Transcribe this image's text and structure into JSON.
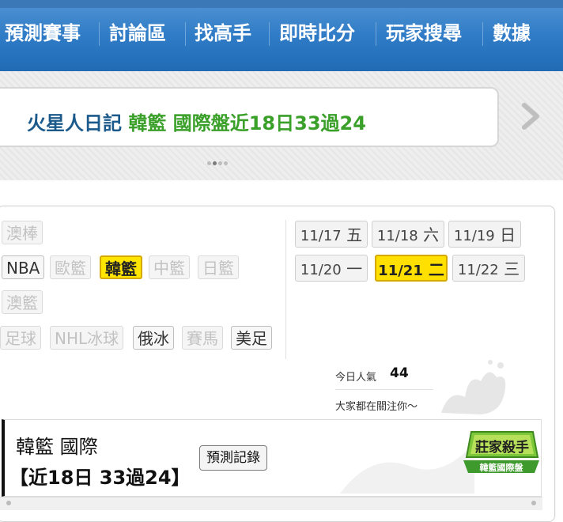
{
  "nav": {
    "items": [
      "預測賽事",
      "討論區",
      "找高手",
      "即時比分",
      "玩家搜尋",
      "數據"
    ]
  },
  "banner": {
    "name": "火星人日記",
    "category": "韓籃",
    "headline": "國際盤近18日33過24",
    "icons": {
      "next": "chevron-right-icon"
    },
    "slide_count": 4,
    "active_slide": 2
  },
  "filters": {
    "rows": [
      [
        {
          "label": "澳棒",
          "state": "off"
        }
      ],
      [
        {
          "label": "NBA",
          "state": "on"
        },
        {
          "label": "歐籃",
          "state": "off"
        },
        {
          "label": "韓籃",
          "state": "selected"
        },
        {
          "label": "中籃",
          "state": "off"
        },
        {
          "label": "日籃",
          "state": "off"
        }
      ],
      [
        {
          "label": "澳籃",
          "state": "off"
        }
      ],
      [
        {
          "label": "足球",
          "state": "off"
        },
        {
          "label": "NHL冰球",
          "state": "off"
        },
        {
          "label": "俄冰",
          "state": "on"
        },
        {
          "label": "賽馬",
          "state": "off"
        },
        {
          "label": "美足",
          "state": "on"
        }
      ]
    ]
  },
  "dates": [
    {
      "date": "11/17",
      "weekday": "五",
      "selected": false
    },
    {
      "date": "11/18",
      "weekday": "六",
      "selected": false
    },
    {
      "date": "11/19",
      "weekday": "日",
      "selected": false
    },
    {
      "date": "11/20",
      "weekday": "一",
      "selected": false
    },
    {
      "date": "11/21",
      "weekday": "二",
      "selected": true
    },
    {
      "date": "11/22",
      "weekday": "三",
      "selected": false
    }
  ],
  "popularity": {
    "label": "今日人氣",
    "value": "44",
    "subtitle": "大家都在關注你～"
  },
  "record": {
    "title": "韓籃 國際",
    "summary": "【近18日 33過24】",
    "button": "預測記錄",
    "badge_line1": "莊家殺手",
    "badge_line2": "韓籃國際盤"
  },
  "colors": {
    "nav_bg": "#2f7bc6",
    "selected": "#ffe500",
    "banner_name": "#1c5a8c",
    "banner_green": "#3aa02a",
    "badge_green": "#3f9a2e"
  }
}
